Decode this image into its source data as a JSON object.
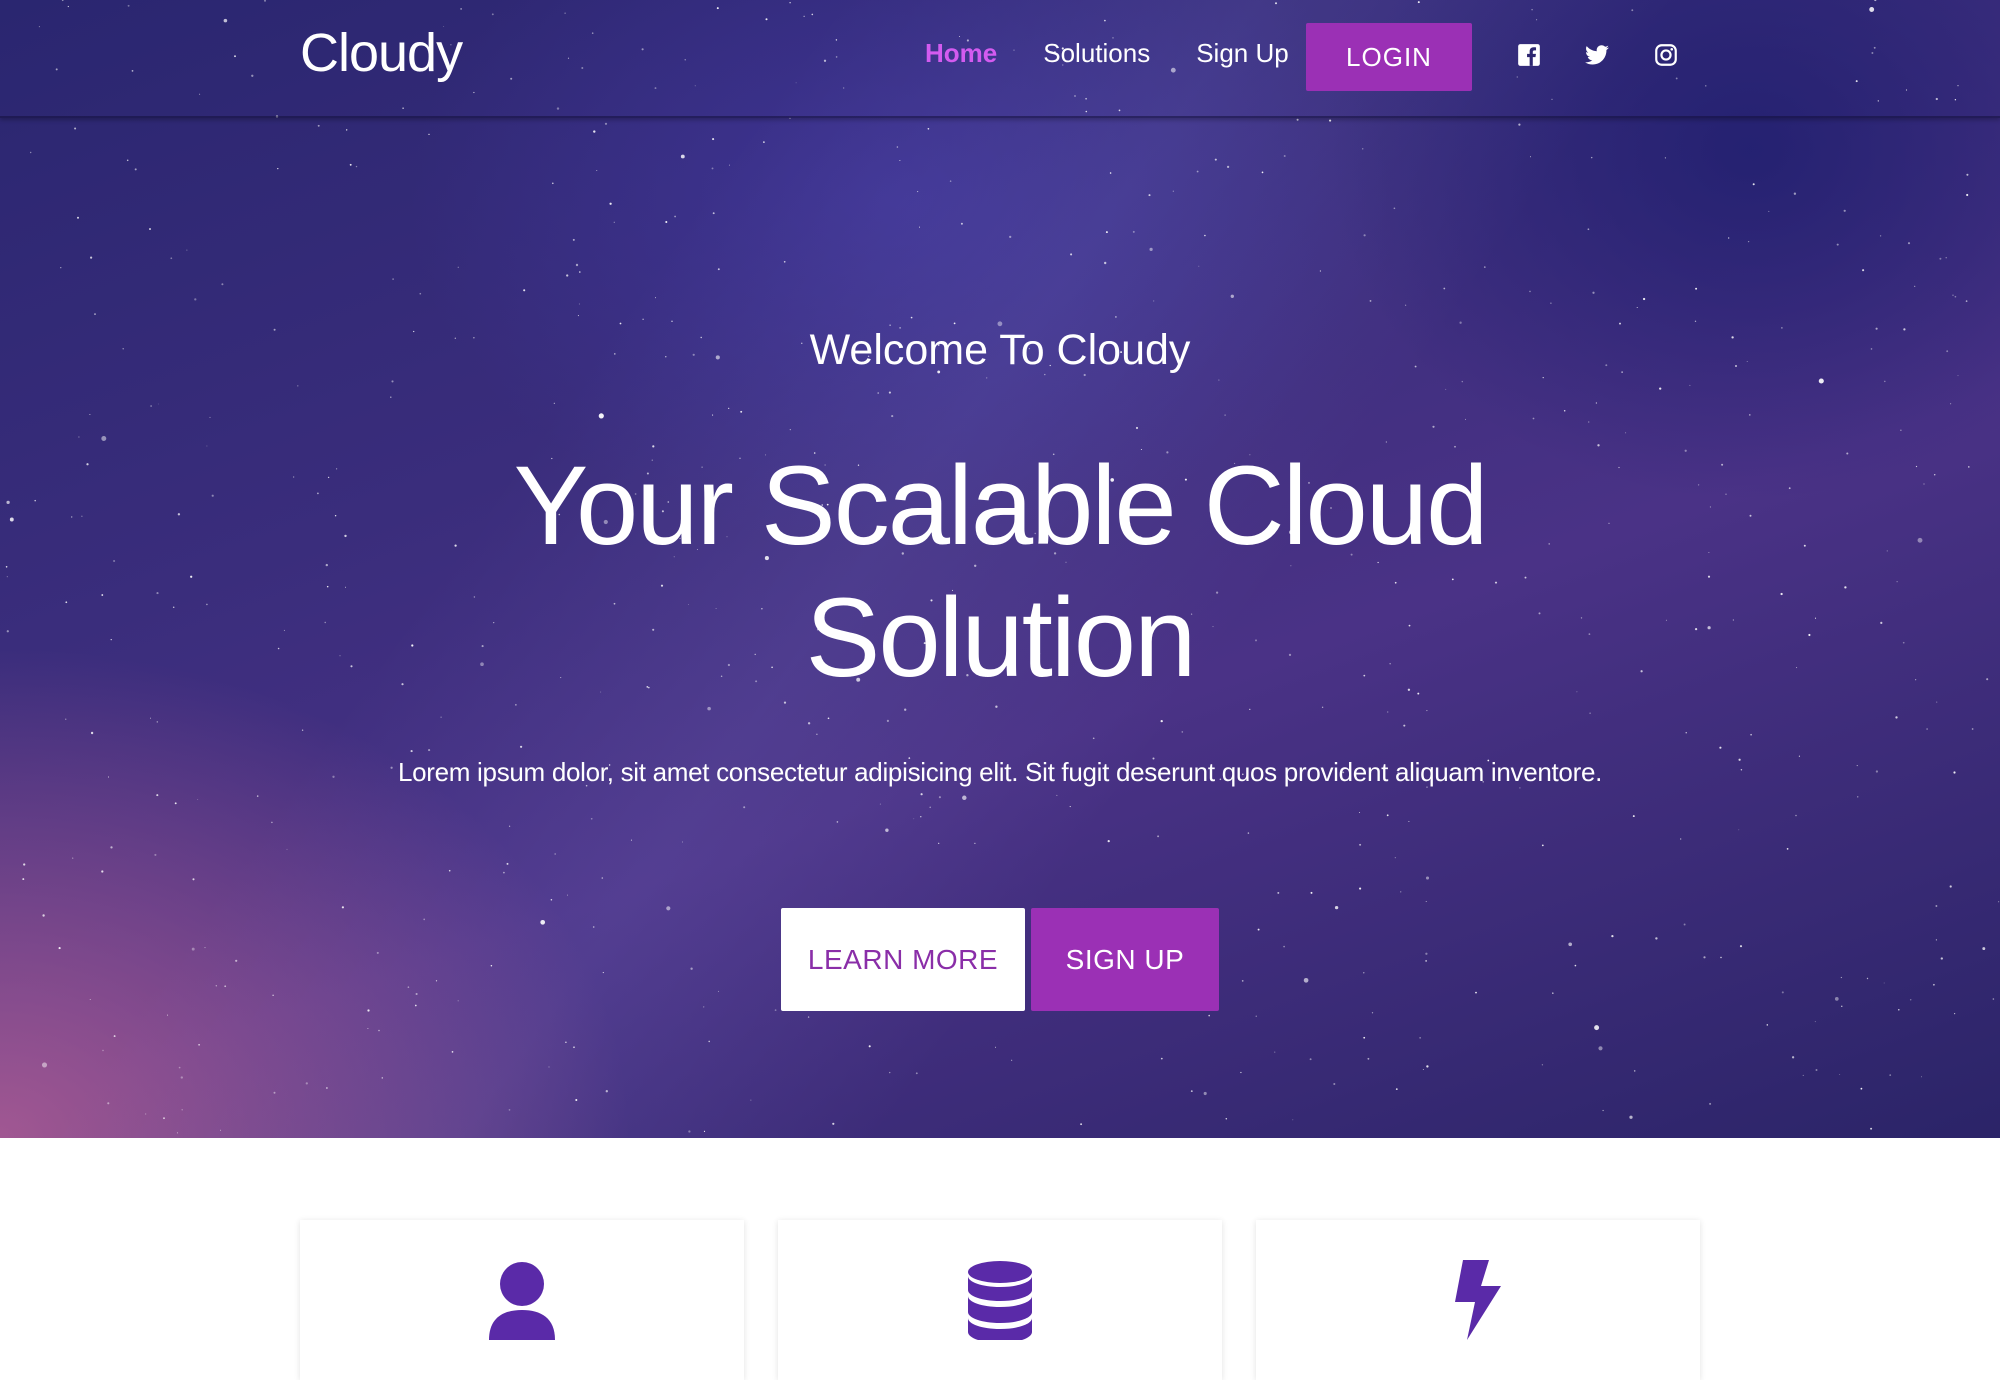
{
  "brand": "Cloudy",
  "nav": {
    "links": [
      "Home",
      "Solutions",
      "Sign Up"
    ],
    "active": "Home",
    "login_label": "LOGIN",
    "social_icons": [
      "facebook-icon",
      "twitter-icon",
      "instagram-icon"
    ]
  },
  "hero": {
    "welcome": "Welcome To Cloudy",
    "headline_line1": "Your Scalable Cloud",
    "headline_line2": "Solution",
    "lead": "Lorem ipsum dolor, sit amet consectetur adipisicing elit. Sit fugit deserunt quos provident aliquam inventore.",
    "learn_more_label": "LEARN MORE",
    "sign_up_label": "SIGN UP"
  },
  "features": {
    "icons": [
      "user-icon",
      "database-icon",
      "bolt-icon"
    ]
  },
  "colors": {
    "accent": "#9b30b5",
    "active_link": "#d35bf0",
    "icon": "#5a2aa8"
  }
}
